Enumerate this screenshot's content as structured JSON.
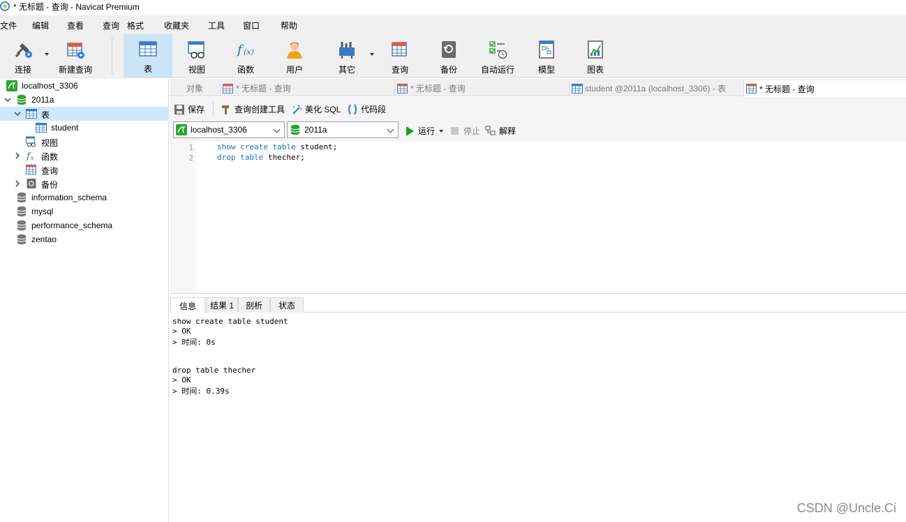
{
  "window": {
    "title": "* 无标题 - 查询 - Navicat Premium"
  },
  "menu": [
    "文件",
    "编辑",
    "查看",
    "查询",
    "格式",
    "收藏夹",
    "工具",
    "窗口",
    "帮助"
  ],
  "toolbar": {
    "connect": "连接",
    "new_query": "新建查询",
    "table": "表",
    "view": "视图",
    "function": "函数",
    "user": "用户",
    "other": "其它",
    "query": "查询",
    "backup": "备份",
    "auto_run": "自动运行",
    "model": "模型",
    "chart": "图表"
  },
  "tree": {
    "connection": "localhost_3306",
    "database": "2011a",
    "tables_node": "表",
    "table_student": "student",
    "views_node": "视图",
    "functions_node": "函数",
    "queries_node": "查询",
    "backups_node": "备份",
    "db_information_schema": "information_schema",
    "db_mysql": "mysql",
    "db_performance_schema": "performance_schema",
    "db_zentao": "zentao"
  },
  "tabs": {
    "objects": "对象",
    "tab1": "* 无标题 - 查询",
    "tab2": "* 无标题 - 查询",
    "tab3": "student @2011a (localhost_3306) - 表",
    "tab4": "* 无标题 - 查询"
  },
  "query_toolbar": {
    "save": "保存",
    "query_builder": "查询创建工具",
    "beautify": "美化 SQL",
    "snippet": "代码段"
  },
  "run_bar": {
    "connection_value": "localhost_3306",
    "database_value": "2011a",
    "run": "运行",
    "stop": "停止",
    "explain": "解释"
  },
  "editor": {
    "lines": [
      {
        "num": "1",
        "kw": "show create table",
        "rest": " student;"
      },
      {
        "num": "2",
        "kw": "drop table",
        "rest": " thecher;"
      }
    ]
  },
  "result_tabs": [
    "信息",
    "结果 1",
    "剖析",
    "状态"
  ],
  "messages": {
    "m1_sql": "show create table student",
    "m1_ok": "> OK",
    "m1_time": "> 时间: 0s",
    "m2_sql": "drop table thecher",
    "m2_ok": "> OK",
    "m2_time": "> 时间: 0.39s"
  },
  "watermark": "CSDN @Uncle.Ci",
  "colors": {
    "accent_selection": "#cce8ff",
    "toolbar_active": "#cce4f7",
    "keyword": "#1a73c8",
    "db_green": "#2aa52a",
    "run_green": "#19a319"
  }
}
